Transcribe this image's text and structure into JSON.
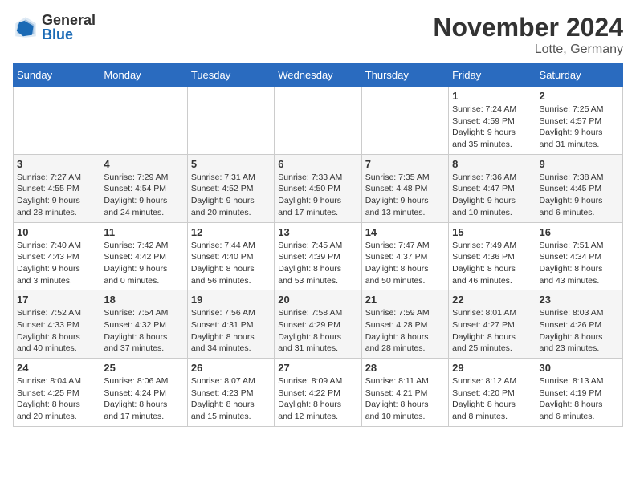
{
  "logo": {
    "general": "General",
    "blue": "Blue"
  },
  "title": {
    "month_year": "November 2024",
    "location": "Lotte, Germany"
  },
  "weekdays": [
    "Sunday",
    "Monday",
    "Tuesday",
    "Wednesday",
    "Thursday",
    "Friday",
    "Saturday"
  ],
  "weeks": [
    [
      {
        "day": "",
        "info": ""
      },
      {
        "day": "",
        "info": ""
      },
      {
        "day": "",
        "info": ""
      },
      {
        "day": "",
        "info": ""
      },
      {
        "day": "",
        "info": ""
      },
      {
        "day": "1",
        "info": "Sunrise: 7:24 AM\nSunset: 4:59 PM\nDaylight: 9 hours\nand 35 minutes."
      },
      {
        "day": "2",
        "info": "Sunrise: 7:25 AM\nSunset: 4:57 PM\nDaylight: 9 hours\nand 31 minutes."
      }
    ],
    [
      {
        "day": "3",
        "info": "Sunrise: 7:27 AM\nSunset: 4:55 PM\nDaylight: 9 hours\nand 28 minutes."
      },
      {
        "day": "4",
        "info": "Sunrise: 7:29 AM\nSunset: 4:54 PM\nDaylight: 9 hours\nand 24 minutes."
      },
      {
        "day": "5",
        "info": "Sunrise: 7:31 AM\nSunset: 4:52 PM\nDaylight: 9 hours\nand 20 minutes."
      },
      {
        "day": "6",
        "info": "Sunrise: 7:33 AM\nSunset: 4:50 PM\nDaylight: 9 hours\nand 17 minutes."
      },
      {
        "day": "7",
        "info": "Sunrise: 7:35 AM\nSunset: 4:48 PM\nDaylight: 9 hours\nand 13 minutes."
      },
      {
        "day": "8",
        "info": "Sunrise: 7:36 AM\nSunset: 4:47 PM\nDaylight: 9 hours\nand 10 minutes."
      },
      {
        "day": "9",
        "info": "Sunrise: 7:38 AM\nSunset: 4:45 PM\nDaylight: 9 hours\nand 6 minutes."
      }
    ],
    [
      {
        "day": "10",
        "info": "Sunrise: 7:40 AM\nSunset: 4:43 PM\nDaylight: 9 hours\nand 3 minutes."
      },
      {
        "day": "11",
        "info": "Sunrise: 7:42 AM\nSunset: 4:42 PM\nDaylight: 9 hours\nand 0 minutes."
      },
      {
        "day": "12",
        "info": "Sunrise: 7:44 AM\nSunset: 4:40 PM\nDaylight: 8 hours\nand 56 minutes."
      },
      {
        "day": "13",
        "info": "Sunrise: 7:45 AM\nSunset: 4:39 PM\nDaylight: 8 hours\nand 53 minutes."
      },
      {
        "day": "14",
        "info": "Sunrise: 7:47 AM\nSunset: 4:37 PM\nDaylight: 8 hours\nand 50 minutes."
      },
      {
        "day": "15",
        "info": "Sunrise: 7:49 AM\nSunset: 4:36 PM\nDaylight: 8 hours\nand 46 minutes."
      },
      {
        "day": "16",
        "info": "Sunrise: 7:51 AM\nSunset: 4:34 PM\nDaylight: 8 hours\nand 43 minutes."
      }
    ],
    [
      {
        "day": "17",
        "info": "Sunrise: 7:52 AM\nSunset: 4:33 PM\nDaylight: 8 hours\nand 40 minutes."
      },
      {
        "day": "18",
        "info": "Sunrise: 7:54 AM\nSunset: 4:32 PM\nDaylight: 8 hours\nand 37 minutes."
      },
      {
        "day": "19",
        "info": "Sunrise: 7:56 AM\nSunset: 4:31 PM\nDaylight: 8 hours\nand 34 minutes."
      },
      {
        "day": "20",
        "info": "Sunrise: 7:58 AM\nSunset: 4:29 PM\nDaylight: 8 hours\nand 31 minutes."
      },
      {
        "day": "21",
        "info": "Sunrise: 7:59 AM\nSunset: 4:28 PM\nDaylight: 8 hours\nand 28 minutes."
      },
      {
        "day": "22",
        "info": "Sunrise: 8:01 AM\nSunset: 4:27 PM\nDaylight: 8 hours\nand 25 minutes."
      },
      {
        "day": "23",
        "info": "Sunrise: 8:03 AM\nSunset: 4:26 PM\nDaylight: 8 hours\nand 23 minutes."
      }
    ],
    [
      {
        "day": "24",
        "info": "Sunrise: 8:04 AM\nSunset: 4:25 PM\nDaylight: 8 hours\nand 20 minutes."
      },
      {
        "day": "25",
        "info": "Sunrise: 8:06 AM\nSunset: 4:24 PM\nDaylight: 8 hours\nand 17 minutes."
      },
      {
        "day": "26",
        "info": "Sunrise: 8:07 AM\nSunset: 4:23 PM\nDaylight: 8 hours\nand 15 minutes."
      },
      {
        "day": "27",
        "info": "Sunrise: 8:09 AM\nSunset: 4:22 PM\nDaylight: 8 hours\nand 12 minutes."
      },
      {
        "day": "28",
        "info": "Sunrise: 8:11 AM\nSunset: 4:21 PM\nDaylight: 8 hours\nand 10 minutes."
      },
      {
        "day": "29",
        "info": "Sunrise: 8:12 AM\nSunset: 4:20 PM\nDaylight: 8 hours\nand 8 minutes."
      },
      {
        "day": "30",
        "info": "Sunrise: 8:13 AM\nSunset: 4:19 PM\nDaylight: 8 hours\nand 6 minutes."
      }
    ]
  ]
}
